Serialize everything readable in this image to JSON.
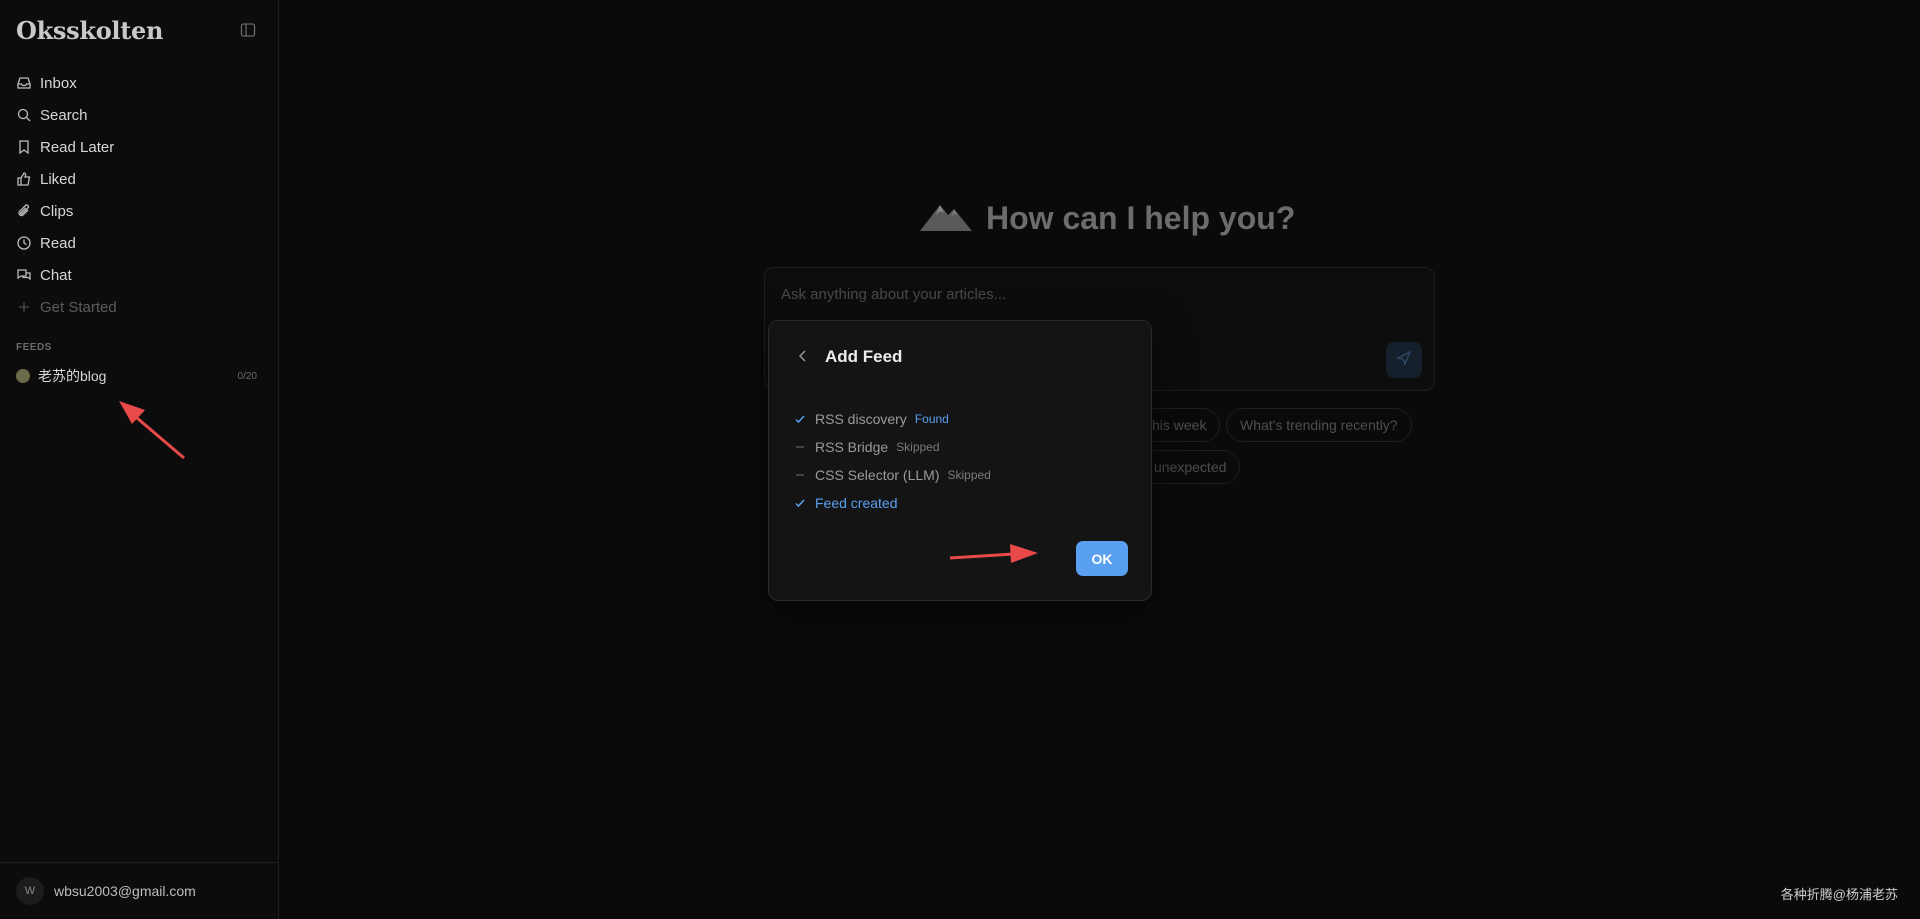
{
  "sidebar": {
    "brand": "Oksskolten",
    "nav": [
      {
        "label": "Inbox",
        "icon": "inbox-icon"
      },
      {
        "label": "Search",
        "icon": "search-icon"
      },
      {
        "label": "Read Later",
        "icon": "bookmark-icon"
      },
      {
        "label": "Liked",
        "icon": "thumbs-up-icon"
      },
      {
        "label": "Clips",
        "icon": "paperclip-icon"
      },
      {
        "label": "Read",
        "icon": "clock-icon"
      },
      {
        "label": "Chat",
        "icon": "chat-icon"
      },
      {
        "label": "Get Started",
        "icon": "plus-icon"
      }
    ],
    "feeds_label": "FEEDS",
    "feed": {
      "name": "老苏的blog",
      "count": "0/20"
    },
    "user": {
      "avatar_letter": "W",
      "email": "wbsu2003@gmail.com"
    }
  },
  "main": {
    "hero_title": "How can I help you?",
    "ask_placeholder": "Ask anything about your articles...",
    "chips": [
      "his week",
      "What's trending recently?",
      "unexpected"
    ]
  },
  "modal": {
    "title": "Add Feed",
    "steps": [
      {
        "label": "RSS discovery",
        "status": "done",
        "badge": "Found"
      },
      {
        "label": "RSS Bridge",
        "status": "skipped",
        "badge": "Skipped"
      },
      {
        "label": "CSS Selector (LLM)",
        "status": "skipped",
        "badge": "Skipped"
      },
      {
        "label": "Feed created",
        "status": "done",
        "badge": ""
      }
    ],
    "ok_label": "OK"
  },
  "watermark": "各种折腾@杨浦老苏",
  "colors": {
    "accent": "#5aa0f0",
    "annotation_arrow": "#e84a4a"
  }
}
